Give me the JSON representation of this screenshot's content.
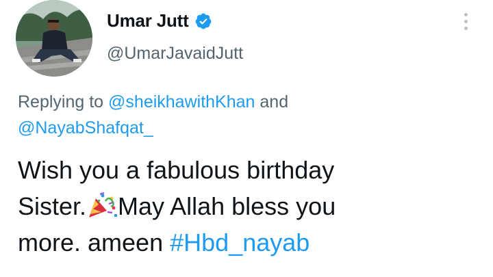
{
  "author": {
    "display_name": "Umar Jutt",
    "handle": "@UmarJavaidJutt",
    "verified": true,
    "verified_color": "#1d9bf0"
  },
  "reply": {
    "prefix": "Replying to ",
    "mention_1": "@sheikhawithKhan",
    "joiner": " and",
    "mention_2": "@NayabShafqat_"
  },
  "tweet": {
    "line_1": "Wish you a fabulous birthday",
    "line_2a": "Sister.",
    "emoji": "party-popper",
    "line_2b": "May Allah bless you",
    "line_3a": "more. ameen ",
    "hashtag": "#Hbd_nayab"
  },
  "colors": {
    "link": "#1d9bf0",
    "secondary_text": "#536471",
    "primary_text": "#0f1419"
  }
}
